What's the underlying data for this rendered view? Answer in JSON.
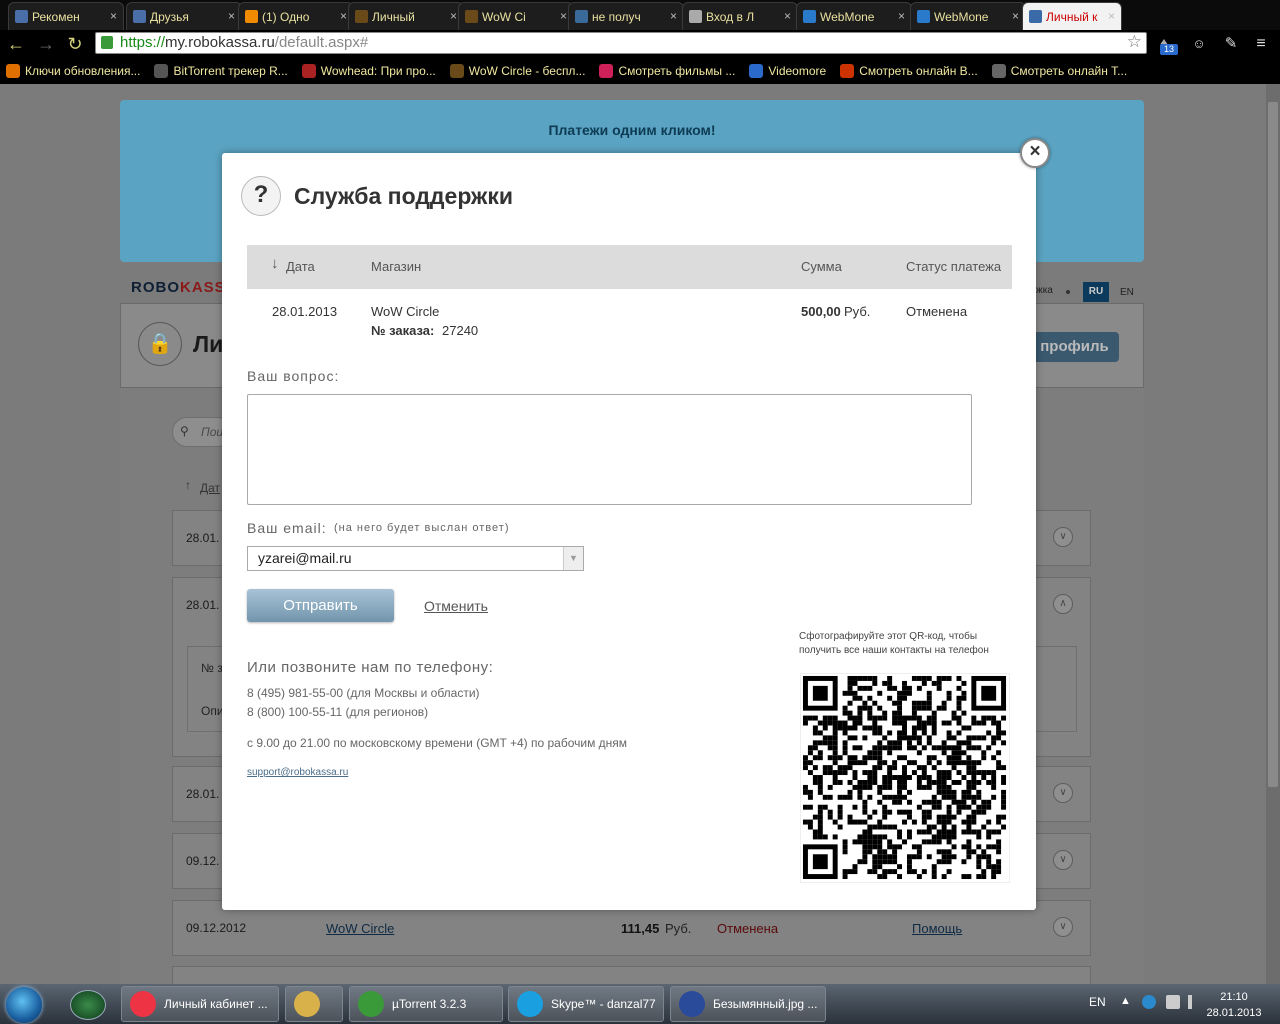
{
  "browser": {
    "tabs": [
      {
        "label": "Рекомен",
        "icon": "vk-icon",
        "color": "#4a6ea8"
      },
      {
        "label": "Друзья",
        "icon": "vk-icon",
        "color": "#4a6ea8"
      },
      {
        "label": "(1) Одно",
        "icon": "odnoklassniki-icon",
        "color": "#f08a00"
      },
      {
        "label": "Личный",
        "icon": "wow-icon",
        "color": "#6b4a1a"
      },
      {
        "label": "WoW Ci",
        "icon": "wow-icon",
        "color": "#6b4a1a"
      },
      {
        "label": "не получ",
        "icon": "forum-icon",
        "color": "#3a6a9a"
      },
      {
        "label": "Вход в Л",
        "icon": "page-icon",
        "color": "#aaaaaa"
      },
      {
        "label": "WebMone",
        "icon": "webmoney-icon",
        "color": "#2a7acc"
      },
      {
        "label": "WebMone",
        "icon": "webmoney-icon",
        "color": "#2a7acc"
      },
      {
        "label": "Личный к",
        "icon": "user-icon",
        "color": "#3a6aa8"
      }
    ],
    "url_scheme": "https://",
    "url_host": "my.robokassa.ru",
    "url_path": "/default.aspx#",
    "badge": "13",
    "bookmarks": [
      {
        "label": "Ключи обновления...",
        "icon": "key-icon",
        "color": "#e07000"
      },
      {
        "label": "BitTorrent трекер R...",
        "icon": "tracker-icon",
        "color": "#555555"
      },
      {
        "label": "Wowhead: При про...",
        "icon": "wowhead-icon",
        "color": "#aa2222"
      },
      {
        "label": "WoW Circle - беспл...",
        "icon": "wow-icon",
        "color": "#6b4a1a"
      },
      {
        "label": "Смотреть фильмы ...",
        "icon": "ivi-icon",
        "color": "#d0205a"
      },
      {
        "label": "Videomore",
        "icon": "play-icon",
        "color": "#2a6acc"
      },
      {
        "label": "Смотреть онлайн В...",
        "icon": "f-icon",
        "color": "#cc3300"
      },
      {
        "label": "Смотреть онлайн Т...",
        "icon": "x-icon",
        "color": "#666666"
      }
    ]
  },
  "page": {
    "banner_text": "Платежи одним кликом!",
    "logo_robo": "ROBO",
    "logo_kassa": "KASSA",
    "lang_ru": "RU",
    "lang_en": "EN",
    "lang_support": "жка",
    "title_partial": "Ли",
    "profile_button": "профиль",
    "search_placeholder": "Пои",
    "date_header": "Дат",
    "rows": [
      {
        "date": "28.01."
      },
      {
        "date": "28.01."
      },
      {
        "date": "28.01."
      },
      {
        "date": "09.12."
      },
      {
        "date": "09.12.2012",
        "shop": "WoW Circle",
        "amount": "111,45",
        "currency": "Руб.",
        "status": "Отменена",
        "help": "Помощь"
      }
    ],
    "detail_order": "№ з",
    "detail_desc": "Опи"
  },
  "modal": {
    "title": "Служба поддержки",
    "table": {
      "headers": [
        "Дата",
        "Магазин",
        "Сумма",
        "Статус платежа"
      ],
      "row": {
        "date": "28.01.2013",
        "shop": "WoW Circle",
        "order_label": "№ заказа:",
        "order_number": "27240",
        "amount": "500,00",
        "currency": "Руб.",
        "status": "Отменена"
      }
    },
    "question_label": "Ваш вопрос:",
    "email_label": "Ваш email:",
    "email_hint": "(на него будет выслан ответ)",
    "email_value": "yzarei@mail.ru",
    "send_button": "Отправить",
    "cancel_link": "Отменить",
    "phone_heading": "Или позвоните нам по телефону:",
    "phone_moscow": "8 (495) 981-55-00 (для Москвы и области)",
    "phone_regions": "8 (800) 100-55-11 (для регионов)",
    "hours": "с 9.00 до 21.00 по московскому времени (GMT +4) по рабочим дням",
    "support_email": "support@robokassa.ru",
    "qr_caption_1": "Сфотографируйте этот QR-код, чтобы",
    "qr_caption_2": "получить все наши контакты на телефон"
  },
  "taskbar": {
    "items": [
      {
        "label": "Личный кабинет ...",
        "icon": "chrome-icon"
      },
      {
        "label": "",
        "icon": "folder-icon"
      },
      {
        "label": "µTorrent 3.2.3",
        "icon": "utorrent-icon"
      },
      {
        "label": "Skype™ - danzal77",
        "icon": "skype-icon"
      },
      {
        "label": "Безымянный.jpg ...",
        "icon": "paint-icon"
      }
    ],
    "lang": "EN",
    "time": "21:10",
    "date": "28.01.2013"
  }
}
